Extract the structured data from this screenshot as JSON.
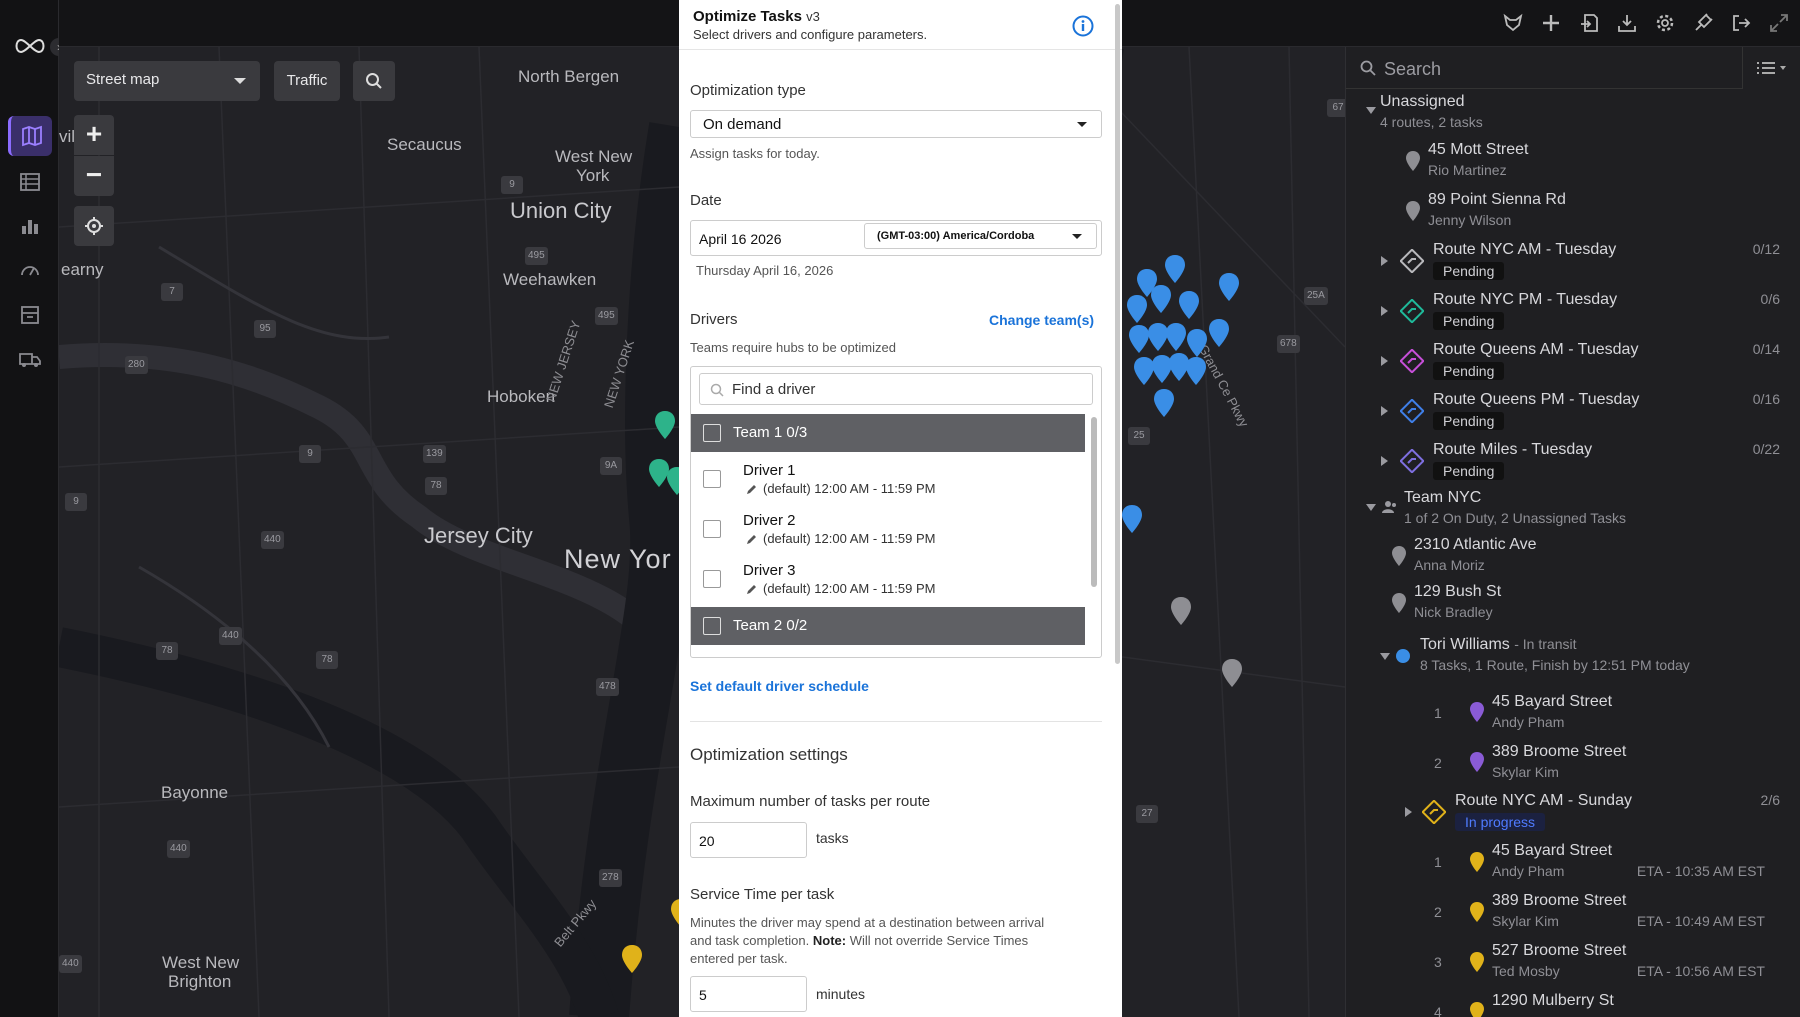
{
  "map": {
    "type_select": "Street map",
    "traffic_label": "Traffic",
    "zoom_in": "+",
    "zoom_out": "−",
    "labels": [
      {
        "t": "North Bergen"
      },
      {
        "t": "Secaucus"
      },
      {
        "t": "West New"
      },
      {
        "t": "York"
      },
      {
        "t": "Union City"
      },
      {
        "t": "Weehawken"
      },
      {
        "t": "earny"
      },
      {
        "t": "Hoboken"
      },
      {
        "t": "Jersey City"
      },
      {
        "t": "New Yor"
      },
      {
        "t": "Bayonne"
      },
      {
        "t": "West New"
      },
      {
        "t": "Brighton"
      },
      {
        "t": "NEW JERSEY"
      },
      {
        "t": "NEW YORK"
      },
      {
        "t": "Grand Ce Pkwy"
      },
      {
        "t": "Belt Pkwy"
      },
      {
        "t": "vil"
      }
    ]
  },
  "modal": {
    "title": "Optimize Tasks",
    "version": "v3",
    "subtitle": "Select drivers and configure parameters.",
    "opt_type_label": "Optimization type",
    "opt_type_value": "On demand",
    "opt_type_hint": "Assign tasks for today.",
    "date_label": "Date",
    "date_value": "April 16 2026",
    "timezone": "(GMT-03:00) America/Cordoba",
    "date_long": "Thursday April 16, 2026",
    "drivers_label": "Drivers",
    "change_teams": "Change team(s)",
    "drivers_hint": "Teams require hubs to be optimized",
    "find_driver_placeholder": "Find a driver",
    "team1": "Team 1 0/3",
    "team2": "Team 2 0/2",
    "drivers": [
      {
        "name": "Driver 1",
        "schedule": "(default) 12:00 AM - 11:59 PM"
      },
      {
        "name": "Driver 2",
        "schedule": "(default) 12:00 AM - 11:59 PM"
      },
      {
        "name": "Driver 3",
        "schedule": "(default) 12:00 AM - 11:59 PM"
      }
    ],
    "set_default_schedule": "Set default driver schedule",
    "settings_title": "Optimization settings",
    "max_tasks_label": "Maximum number of tasks per route",
    "max_tasks_value": "20",
    "max_tasks_unit": "tasks",
    "service_time_label": "Service Time per task",
    "service_time_hint_a": "Minutes the driver may spend at a destination between arrival",
    "service_time_hint_b": "and task completion.",
    "service_time_note_label": "Note:",
    "service_time_note": "Will not override Service Times",
    "service_time_hint_c": "entered per task.",
    "service_time_value": "5",
    "service_time_unit": "minutes"
  },
  "panel": {
    "search_placeholder": "Search",
    "unassigned": {
      "title": "Unassigned",
      "sub": "4 routes, 2 tasks"
    },
    "unassigned_tasks": [
      {
        "addr": "45 Mott Street",
        "name": "Rio Martinez"
      },
      {
        "addr": "89 Point Sienna Rd",
        "name": "Jenny Wilson"
      }
    ],
    "routes": [
      {
        "name": "Route NYC AM - Tuesday",
        "status": "Pending",
        "count": "0/12",
        "color": "#b8b8bc"
      },
      {
        "name": "Route NYC PM - Tuesday",
        "status": "Pending",
        "count": "0/6",
        "color": "#1fb99a"
      },
      {
        "name": "Route Queens AM - Tuesday",
        "status": "Pending",
        "count": "0/14",
        "color": "#c64fd8"
      },
      {
        "name": "Route Queens PM - Tuesday",
        "status": "Pending",
        "count": "0/16",
        "color": "#3f7fe8"
      },
      {
        "name": "Route Miles - Tuesday",
        "status": "Pending",
        "count": "0/22",
        "color": "#7e6fe0"
      }
    ],
    "team": {
      "title": "Team NYC",
      "sub": "1 of 2 On Duty, 2 Unassigned Tasks"
    },
    "team_tasks": [
      {
        "addr": "2310 Atlantic Ave",
        "name": "Anna Moriz"
      },
      {
        "addr": "129 Bush St",
        "name": "Nick Bradley"
      }
    ],
    "driver": {
      "name": "Tori Williams",
      "status": "- In transit",
      "sub": "8 Tasks, 1 Route, Finish by 12:51 PM today"
    },
    "driver_tasks": [
      {
        "n": "1",
        "addr": "45 Bayard Street",
        "name": "Andy Pham"
      },
      {
        "n": "2",
        "addr": "389 Broome Street",
        "name": "Skylar Kim"
      }
    ],
    "driver_route": {
      "name": "Route NYC AM - Sunday",
      "status": "In progress",
      "count": "2/6",
      "color": "#e0b21a"
    },
    "route_tasks": [
      {
        "n": "1",
        "addr": "45 Bayard Street",
        "name": "Andy Pham",
        "eta": "ETA - 10:35 AM EST"
      },
      {
        "n": "2",
        "addr": "389 Broome Street",
        "name": "Skylar Kim",
        "eta": "ETA - 10:49 AM EST"
      },
      {
        "n": "3",
        "addr": "527 Broome Street",
        "name": "Ted Mosby",
        "eta": "ETA - 10:56 AM EST"
      },
      {
        "n": "4",
        "addr": "1290 Mulberry St",
        "name": "",
        "eta": ""
      }
    ]
  },
  "colors": {
    "accent": "#1a73d9",
    "nav_active": "#8b6cff",
    "pin_blue": "#3a8ee6",
    "pin_green": "#2db38a",
    "pin_yellow": "#e0b21a",
    "pin_gray": "#8e8e93"
  }
}
